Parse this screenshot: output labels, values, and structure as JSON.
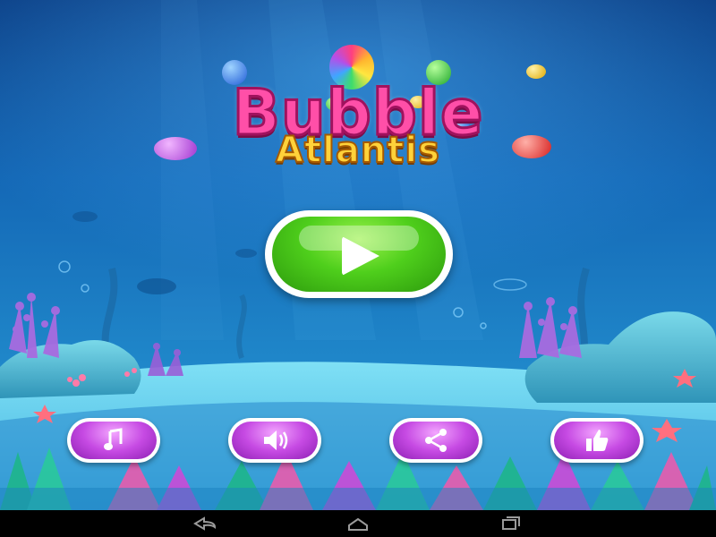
{
  "game": {
    "title_line1": "Bubble",
    "title_line2": "Atlantis"
  },
  "icons": {
    "play": "play-icon",
    "music": "music-note-icon",
    "sound": "speaker-icon",
    "share": "share-icon",
    "like": "thumbs-up-icon",
    "nav_back": "back-arrow-icon",
    "nav_home": "home-icon",
    "nav_recent": "recent-apps-icon"
  },
  "colors": {
    "water_top": "#0a4f9a",
    "water_bottom": "#38b6e6",
    "play_green": "#4fcf1c",
    "button_purple": "#c64ae3",
    "title_pink": "#ff4fa8",
    "title_yellow": "#ffd23a",
    "navbar": "#000000"
  }
}
